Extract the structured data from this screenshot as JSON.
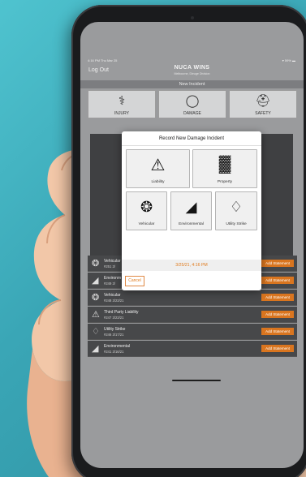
{
  "status": {
    "time": "4:16 PM  Thu Mar 25",
    "battery": "▾ 59% ▬"
  },
  "nav": {
    "logout": "Log Out",
    "title": "NUCA WINS",
    "subtitle": "Melbourne, Dieuge Division"
  },
  "section": {
    "label": "New Incident"
  },
  "categories": [
    {
      "label": "INJURY",
      "icon": "syringe-icon",
      "glyph": "⚕"
    },
    {
      "label": "DAMAGE",
      "icon": "egg-icon",
      "glyph": "◯"
    },
    {
      "label": "SAFETY",
      "icon": "hardhat-icon",
      "glyph": "⛑"
    }
  ],
  "modal": {
    "title": "Record New Damage Incident",
    "options": [
      {
        "label": "Liability",
        "icon": "slip-fall-icon",
        "glyph": "⚠"
      },
      {
        "label": "Property",
        "icon": "building-icon",
        "glyph": "▓"
      },
      {
        "label": "Vehicular",
        "icon": "steering-wheel-icon",
        "glyph": "❂"
      },
      {
        "label": "Environmental",
        "icon": "spill-icon",
        "glyph": "◢"
      },
      {
        "label": "Utility Strike",
        "icon": "power-tower-icon",
        "glyph": "♢"
      }
    ],
    "datetime": "3/25/21, 4:16 PM",
    "cancel": "Cancel"
  },
  "incidents": [
    {
      "title": "Vehicular",
      "sub": "#251  3/",
      "action": "Add Statement",
      "icon": "steering-wheel-icon",
      "glyph": "❂"
    },
    {
      "title": "Environm",
      "sub": "#249  3/",
      "action": "Add Statement",
      "icon": "spill-icon",
      "glyph": "◢"
    },
    {
      "title": "Vehicular",
      "sub": "#248  3/23/21",
      "action": "Add Statement",
      "icon": "steering-wheel-icon",
      "glyph": "❂"
    },
    {
      "title": "Third Party Liability",
      "sub": "#247  3/23/21",
      "action": "Add Statement",
      "icon": "slip-fall-icon",
      "glyph": "⚠"
    },
    {
      "title": "Utility Strike",
      "sub": "#246  3/17/21",
      "action": "Add Statement",
      "icon": "power-tower-icon",
      "glyph": "♢"
    },
    {
      "title": "Environmental",
      "sub": "#241  3/16/21",
      "action": "Add Statement",
      "icon": "spill-icon",
      "glyph": "◢"
    }
  ],
  "colors": {
    "accent": "#d9751f",
    "background": "#4fc3cf",
    "screen": "#9a9b9d"
  }
}
